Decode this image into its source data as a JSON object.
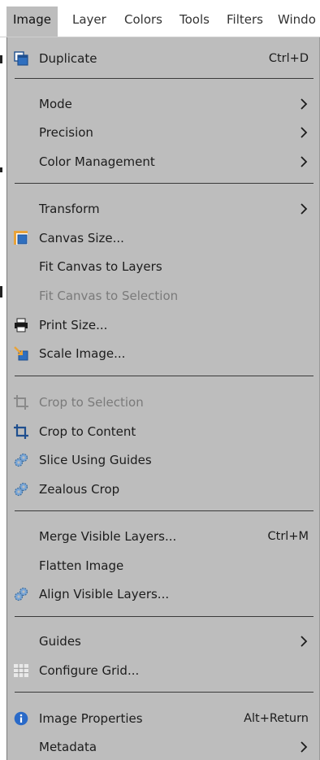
{
  "menubar": {
    "items": [
      {
        "label": "Image",
        "active": true
      },
      {
        "label": "Layer"
      },
      {
        "label": "Colors"
      },
      {
        "label": "Tools"
      },
      {
        "label": "Filters"
      },
      {
        "label": "Windo"
      }
    ]
  },
  "menu": {
    "duplicate": {
      "label": "Duplicate",
      "shortcut": "Ctrl+D",
      "icon": "duplicate-icon"
    },
    "mode": {
      "label": "Mode"
    },
    "precision": {
      "label": "Precision"
    },
    "color_management": {
      "label": "Color Management"
    },
    "transform": {
      "label": "Transform"
    },
    "canvas_size": {
      "label": "Canvas Size...",
      "icon": "canvas-size-icon"
    },
    "fit_canvas_layers": {
      "label": "Fit Canvas to Layers"
    },
    "fit_canvas_selection": {
      "label": "Fit Canvas to Selection",
      "disabled": true
    },
    "print_size": {
      "label": "Print Size...",
      "icon": "printer-icon"
    },
    "scale_image": {
      "label": "Scale Image...",
      "icon": "scale-image-icon"
    },
    "crop_selection": {
      "label": "Crop to Selection",
      "disabled": true,
      "icon": "crop-icon"
    },
    "crop_content": {
      "label": "Crop to Content",
      "icon": "crop-icon"
    },
    "slice_guides": {
      "label": "Slice Using Guides",
      "icon": "gears-icon"
    },
    "zealous_crop": {
      "label": "Zealous Crop",
      "icon": "gears-icon"
    },
    "merge_visible": {
      "label": "Merge Visible Layers...",
      "shortcut": "Ctrl+M"
    },
    "flatten": {
      "label": "Flatten Image"
    },
    "align_visible": {
      "label": "Align Visible Layers...",
      "icon": "gears-icon"
    },
    "guides": {
      "label": "Guides"
    },
    "configure_grid": {
      "label": "Configure Grid...",
      "icon": "grid-icon"
    },
    "image_properties": {
      "label": "Image Properties",
      "shortcut": "Alt+Return",
      "icon": "info-icon"
    },
    "metadata": {
      "label": "Metadata"
    }
  },
  "colors": {
    "menu_bg": "#bdbdbd",
    "text": "#1c1c1c",
    "disabled_text": "#7a7a7a",
    "icon_blue": "#2f6fbf",
    "icon_orange": "#e8a33a"
  }
}
